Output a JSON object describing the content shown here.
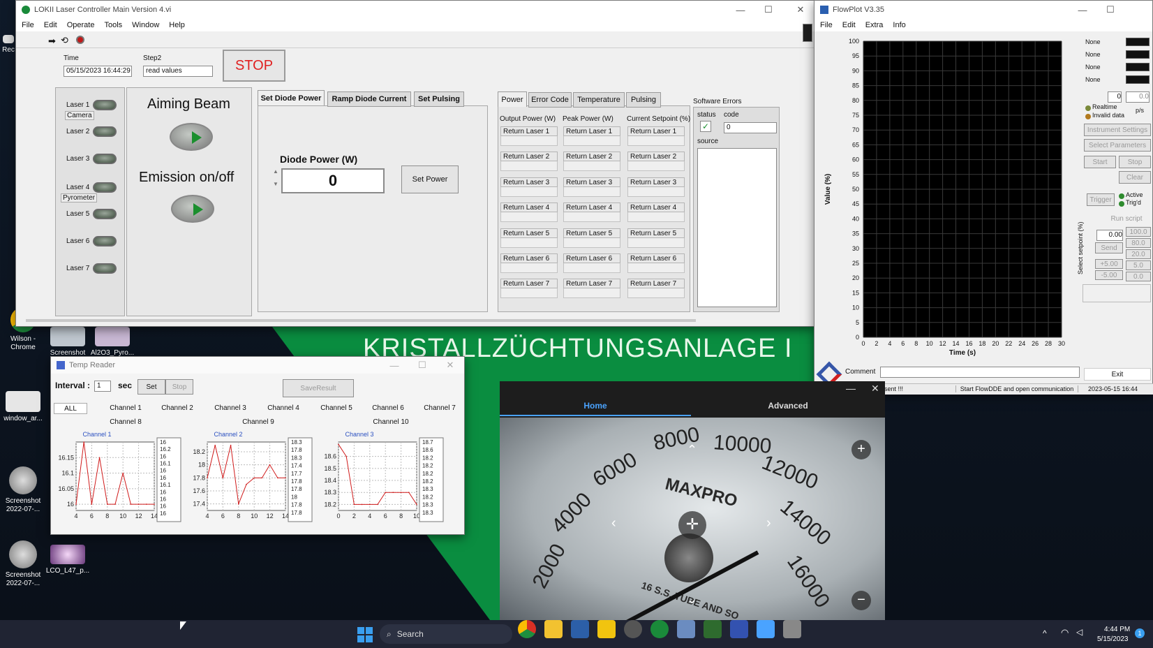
{
  "desktop": {
    "banner_text": "KRISTALLZÜCHTUNGSANLAGE I",
    "icons": [
      {
        "label": "Rec",
        "name": "recycle-bin-icon"
      },
      {
        "label": "Wilson - Chrome",
        "name": "chrome-shortcut-icon"
      },
      {
        "label": "Screenshot 2022-07...",
        "name": "screenshot-file-icon"
      },
      {
        "label": "Al2O3_Pyro...",
        "name": "pyro-file-icon"
      },
      {
        "label": "window_ar...",
        "name": "window-file-icon"
      },
      {
        "label": "Screenshot 2022-07-...",
        "name": "screenshot-gauge-icon"
      },
      {
        "label": "Screenshot 2022-07-...",
        "name": "screenshot-gauge-icon-2"
      },
      {
        "label": "LCO_L47_p...",
        "name": "lco-file-icon"
      }
    ]
  },
  "lokii": {
    "title": "LOKII Laser Controller Main Version 4.vi",
    "menu": [
      "File",
      "Edit",
      "Operate",
      "Tools",
      "Window",
      "Help"
    ],
    "time_label": "Time",
    "time_value": "05/15/2023 16:44:29",
    "step_label": "Step2",
    "step_value": "read values",
    "stop_label": "STOP",
    "lasers": [
      "Laser 1",
      "Laser 2",
      "Laser 3",
      "Laser 4",
      "Laser 5",
      "Laser 6",
      "Laser 7"
    ],
    "camera_label": "Camera",
    "pyrometer_label": "Pyrometer",
    "aiming_beam_label": "Aiming Beam",
    "emission_label": "Emission on/off",
    "tabs": [
      "Set Diode Power",
      "Ramp Diode Current",
      "Set Pulsing"
    ],
    "diode_power_label": "Diode Power (W)",
    "diode_power_value": "0",
    "set_power_label": "Set Power",
    "right_tabs": [
      "Power",
      "Error Code",
      "Temperature",
      "Pulsing"
    ],
    "col_headers": [
      "Output Power (W)",
      "Peak Power (W)",
      "Current Setpoint (%)"
    ],
    "return_labels": [
      "Return Laser 1",
      "Return Laser 2",
      "Return Laser 3",
      "Return Laser 4",
      "Return Laser 5",
      "Return Laser 6",
      "Return Laser 7"
    ],
    "software_errors_label": "Software Errors",
    "status_label": "status",
    "code_label": "code",
    "code_value": "0",
    "source_label": "source"
  },
  "flowplot": {
    "title": "FlowPlot V3.35",
    "menu": [
      "File",
      "Edit",
      "Extra",
      "Info"
    ],
    "y_label": "Value (%)",
    "x_label": "Time (s)",
    "y_ticks": [
      "100",
      "95",
      "90",
      "85",
      "80",
      "75",
      "70",
      "65",
      "60",
      "55",
      "50",
      "45",
      "40",
      "35",
      "30",
      "25",
      "20",
      "15",
      "10",
      "5",
      "0"
    ],
    "x_ticks": [
      "0",
      "2",
      "4",
      "6",
      "8",
      "10",
      "12",
      "14",
      "16",
      "18",
      "20",
      "22",
      "24",
      "26",
      "28",
      "30"
    ],
    "legend": [
      "None",
      "None",
      "None",
      "None"
    ],
    "spin_value": "0",
    "spin_value2": "0.0",
    "realtime_label": "Realtime",
    "invalid_label": "Invalid data",
    "ps_label": "p/s",
    "instrument_settings": "Instrument Settings",
    "select_parameters": "Select Parameters",
    "start": "Start",
    "stop": "Stop",
    "clear": "Clear",
    "trigger": "Trigger",
    "active": "Active",
    "trigd": "Trig'd",
    "run_script": "Run script",
    "setpoint_label": "Select setpoint (%)",
    "setpoint_value": "0.00",
    "send": "Send",
    "presets": [
      "100.0",
      "80.0",
      "20.0",
      "5.0",
      "0.0"
    ],
    "plus_five": "+5.00",
    "minus_five": "-5.00",
    "comment_label": "Comment",
    "exit_label": "Exit",
    "status_1": "sent !!!",
    "status_2": "Start FlowDDE and open communication",
    "status_3": "2023-05-15  16:44"
  },
  "temp": {
    "title": "Temp Reader",
    "interval_label": "Interval :",
    "interval_value": "1",
    "sec_label": "sec",
    "set_label": "Set",
    "stop_label": "Stop",
    "save_label": "SaveResult",
    "channel_tabs": [
      "ALL",
      "Channel 1",
      "Channel 2",
      "Channel 3",
      "Channel 4",
      "Channel 5",
      "Channel 6",
      "Channel 7"
    ],
    "channel_row2": [
      "Channel 8",
      "Channel 9",
      "Channel 10"
    ]
  },
  "chart_data": [
    {
      "type": "line",
      "title": "Channel 1",
      "x": [
        4,
        5,
        6,
        7,
        8,
        9,
        10,
        11,
        12,
        13,
        14
      ],
      "values": [
        16,
        16.2,
        16,
        16.15,
        16,
        16,
        16.1,
        16,
        16,
        16,
        16
      ],
      "x_ticks": [
        "4",
        "6",
        "8",
        "10",
        "12",
        "14"
      ],
      "y_ticks": [
        "16.15",
        "16.1",
        "16.05",
        "16"
      ],
      "ylim": [
        15.98,
        16.2
      ],
      "readings": [
        "16",
        "16.2",
        "16",
        "16.1",
        "16",
        "16",
        "16.1",
        "16",
        "16",
        "16",
        "16"
      ]
    },
    {
      "type": "line",
      "title": "Channel 2",
      "x": [
        4,
        5,
        6,
        7,
        8,
        9,
        10,
        11,
        12,
        13,
        14
      ],
      "values": [
        17.8,
        18.3,
        17.8,
        18.3,
        17.4,
        17.7,
        17.8,
        17.8,
        18,
        17.8,
        17.8
      ],
      "x_ticks": [
        "4",
        "6",
        "8",
        "10",
        "12",
        "14"
      ],
      "y_ticks": [
        "18.2",
        "18",
        "17.8",
        "17.6",
        "17.4"
      ],
      "ylim": [
        17.3,
        18.35
      ],
      "readings": [
        "18.3",
        "17.8",
        "18.3",
        "17.4",
        "17.7",
        "17.8",
        "17.8",
        "18",
        "17.8",
        "17.8"
      ]
    },
    {
      "type": "line",
      "title": "Channel 3",
      "x": [
        0,
        1,
        2,
        3,
        4,
        5,
        6,
        7,
        8,
        9,
        10
      ],
      "values": [
        18.7,
        18.6,
        18.2,
        18.2,
        18.2,
        18.2,
        18.3,
        18.3,
        18.3,
        18.3,
        18.2
      ],
      "x_ticks": [
        "0",
        "2",
        "4",
        "6",
        "8",
        "10"
      ],
      "y_ticks": [
        "18.6",
        "18.5",
        "18.4",
        "18.3",
        "18.2"
      ],
      "ylim": [
        18.15,
        18.72
      ],
      "readings": [
        "18.7",
        "18.6",
        "18.2",
        "18.2",
        "18.2",
        "18.2",
        "18.3",
        "18.2",
        "18.3",
        "18.3"
      ]
    }
  ],
  "camera": {
    "tabs": [
      "Home",
      "Advanced"
    ],
    "gauge_numbers": [
      "8000",
      "10000",
      "12000",
      "6000",
      "4000",
      "14000",
      "2000",
      "16000"
    ],
    "brand": "MAXPRO",
    "gauge_text": "16 S.S. TUBE AND SO"
  },
  "taskbar": {
    "search_label": "Search",
    "time": "4:44 PM",
    "date": "5/15/2023",
    "notif_count": "1"
  }
}
